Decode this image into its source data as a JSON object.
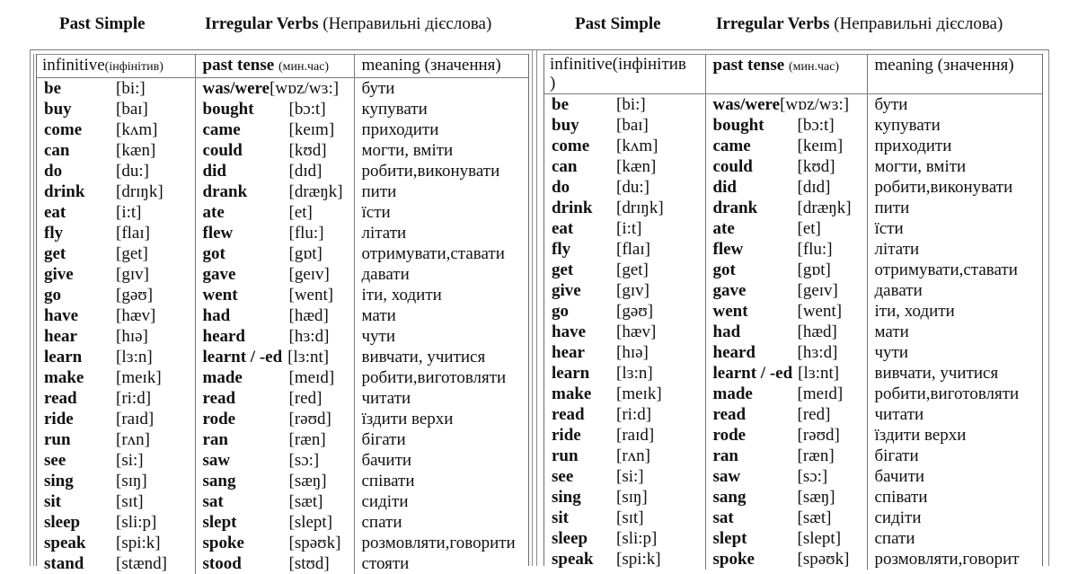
{
  "left": {
    "title_past": "Past Simple",
    "title_irregular": "Irregular Verbs",
    "title_ukr": "(Неправильні дієслова)",
    "headers": {
      "infinitive": "infinitive",
      "infinitive_ukr": "(інфінітив)",
      "past": "past tense",
      "past_ukr": "(мин.час)",
      "meaning": "meaning (значення)"
    },
    "rows": [
      {
        "inf": "be",
        "inf_pron": "[bi:]",
        "past": "was/were",
        "past_pron": "[wɒz/wɜ:]",
        "meaning": "бути"
      },
      {
        "inf": "buy",
        "inf_pron": "[baɪ]",
        "past": "bought",
        "past_pron": "[bɔ:t]",
        "meaning": "купувати"
      },
      {
        "inf": "come",
        "inf_pron": "[kʌm]",
        "past": "came",
        "past_pron": "[keɪm]",
        "meaning": "приходити"
      },
      {
        "inf": "can",
        "inf_pron": "[kæn]",
        "past": "could",
        "past_pron": "[kʊd]",
        "meaning": "могти, вміти"
      },
      {
        "inf": "do",
        "inf_pron": "[du:]",
        "past": "did",
        "past_pron": "[dɪd]",
        "meaning": "робити,виконувати"
      },
      {
        "inf": "drink",
        "inf_pron": "[drɪŋk]",
        "past": "drank",
        "past_pron": "[dræŋk]",
        "meaning": "пити"
      },
      {
        "inf": "eat",
        "inf_pron": "[i:t]",
        "past": "ate",
        "past_pron": "[et]",
        "meaning": "їсти"
      },
      {
        "inf": "fly",
        "inf_pron": "[flaɪ]",
        "past": "flew",
        "past_pron": "[flu:]",
        "meaning": "літати"
      },
      {
        "inf": "get",
        "inf_pron": "[get]",
        "past": "got",
        "past_pron": "[gɒt]",
        "meaning": "отримувати,ставати"
      },
      {
        "inf": "give",
        "inf_pron": "[gɪv]",
        "past": "gave",
        "past_pron": "[geɪv]",
        "meaning": "давати"
      },
      {
        "inf": "go",
        "inf_pron": "[gəʊ]",
        "past": "went",
        "past_pron": "[went]",
        "meaning": "іти, ходити"
      },
      {
        "inf": "have",
        "inf_pron": "[hæv]",
        "past": "had",
        "past_pron": "[hæd]",
        "meaning": "мати"
      },
      {
        "inf": "hear",
        "inf_pron": "[hɪə]",
        "past": "heard",
        "past_pron": "[hɜ:d]",
        "meaning": "чути"
      },
      {
        "inf": "learn",
        "inf_pron": "[lɜ:n]",
        "past": "learnt / -ed",
        "past_pron": "[lɜ:nt]",
        "meaning": "вивчати, учитися"
      },
      {
        "inf": "make",
        "inf_pron": "[meɪk]",
        "past": "made",
        "past_pron": "[meɪd]",
        "meaning": "робити,виготовляти"
      },
      {
        "inf": "read",
        "inf_pron": "[ri:d]",
        "past": "read",
        "past_pron": "[red]",
        "meaning": "читати"
      },
      {
        "inf": "ride",
        "inf_pron": "[raɪd]",
        "past": "rode",
        "past_pron": "[rəʊd]",
        "meaning": "їздити верхи"
      },
      {
        "inf": "run",
        "inf_pron": "[rʌn]",
        "past": "ran",
        "past_pron": "[ræn]",
        "meaning": "бігати"
      },
      {
        "inf": "see",
        "inf_pron": "[si:]",
        "past": "saw",
        "past_pron": "[sɔ:]",
        "meaning": "бачити"
      },
      {
        "inf": "sing",
        "inf_pron": "[sɪŋ]",
        "past": "sang",
        "past_pron": "[sæŋ]",
        "meaning": "співати"
      },
      {
        "inf": "sit",
        "inf_pron": "[sɪt]",
        "past": "sat",
        "past_pron": "[sæt]",
        "meaning": "сидіти"
      },
      {
        "inf": "sleep",
        "inf_pron": "[sli:p]",
        "past": "slept",
        "past_pron": "[slept]",
        "meaning": "спати"
      },
      {
        "inf": "speak",
        "inf_pron": "[spi:k]",
        "past": "spoke",
        "past_pron": "[spəʊk]",
        "meaning": "розмовляти,говорити"
      },
      {
        "inf": "stand",
        "inf_pron": "[stænd]",
        "past": "stood",
        "past_pron": "[stʊd]",
        "meaning": "стояти"
      }
    ]
  },
  "right": {
    "title_past": "Past Simple",
    "title_irregular": "Irregular Verbs",
    "title_ukr": "(Неправильні дієслова)",
    "headers": {
      "infinitive": "infinitive(інфінітив",
      "infinitive_wrap": ")",
      "past": "past tense",
      "past_ukr": "(мин.час)",
      "meaning": "meaning (значення)"
    },
    "rows": [
      {
        "inf": "be",
        "inf_pron": "[bi:]",
        "past": "was/were",
        "past_pron": "[wɒz/wɜ:]",
        "meaning": "бути"
      },
      {
        "inf": "buy",
        "inf_pron": "[baɪ]",
        "past": "bought",
        "past_pron": "[bɔ:t]",
        "meaning": "купувати"
      },
      {
        "inf": "come",
        "inf_pron": "[kʌm]",
        "past": "came",
        "past_pron": "[keɪm]",
        "meaning": "приходити"
      },
      {
        "inf": "can",
        "inf_pron": "[kæn]",
        "past": "could",
        "past_pron": "[kʊd]",
        "meaning": "могти, вміти"
      },
      {
        "inf": "do",
        "inf_pron": "[du:]",
        "past": "did",
        "past_pron": "[dɪd]",
        "meaning": "робити,виконувати"
      },
      {
        "inf": "drink",
        "inf_pron": "[drɪŋk]",
        "past": "drank",
        "past_pron": "[dræŋk]",
        "meaning": "пити"
      },
      {
        "inf": "eat",
        "inf_pron": "[i:t]",
        "past": "ate",
        "past_pron": "[et]",
        "meaning": "їсти"
      },
      {
        "inf": "fly",
        "inf_pron": "[flaɪ]",
        "past": "flew",
        "past_pron": "[flu:]",
        "meaning": "літати"
      },
      {
        "inf": "get",
        "inf_pron": "[get]",
        "past": "got",
        "past_pron": "[gɒt]",
        "meaning": "отримувати,ставати"
      },
      {
        "inf": "give",
        "inf_pron": "[gɪv]",
        "past": "gave",
        "past_pron": "[geɪv]",
        "meaning": "давати"
      },
      {
        "inf": "go",
        "inf_pron": "[gəʊ]",
        "past": "went",
        "past_pron": "[went]",
        "meaning": "іти, ходити"
      },
      {
        "inf": "have",
        "inf_pron": "[hæv]",
        "past": "had",
        "past_pron": "[hæd]",
        "meaning": "мати"
      },
      {
        "inf": "hear",
        "inf_pron": "[hɪə]",
        "past": "heard",
        "past_pron": "[hɜ:d]",
        "meaning": "чути"
      },
      {
        "inf": "learn",
        "inf_pron": "[lɜ:n]",
        "past": "learnt / -ed",
        "past_pron": "[lɜ:nt]",
        "meaning": "вивчати, учитися"
      },
      {
        "inf": "make",
        "inf_pron": "[meɪk]",
        "past": "made",
        "past_pron": "[meɪd]",
        "meaning": "робити,виготовляти"
      },
      {
        "inf": "read",
        "inf_pron": "[ri:d]",
        "past": "read",
        "past_pron": "[red]",
        "meaning": "читати"
      },
      {
        "inf": "ride",
        "inf_pron": "[raɪd]",
        "past": "rode",
        "past_pron": "[rəʊd]",
        "meaning": "їздити верхи"
      },
      {
        "inf": "run",
        "inf_pron": "[rʌn]",
        "past": "ran",
        "past_pron": "[ræn]",
        "meaning": "бігати"
      },
      {
        "inf": "see",
        "inf_pron": "[si:]",
        "past": "saw",
        "past_pron": "[sɔ:]",
        "meaning": "бачити"
      },
      {
        "inf": "sing",
        "inf_pron": "[sɪŋ]",
        "past": "sang",
        "past_pron": "[sæŋ]",
        "meaning": "співати"
      },
      {
        "inf": "sit",
        "inf_pron": "[sɪt]",
        "past": "sat",
        "past_pron": "[sæt]",
        "meaning": "сидіти"
      },
      {
        "inf": "sleep",
        "inf_pron": "[sli:p]",
        "past": "slept",
        "past_pron": "[slept]",
        "meaning": "спати"
      },
      {
        "inf": "speak",
        "inf_pron": "[spi:k]",
        "past": "spoke",
        "past_pron": "[spəʊk]",
        "meaning": "розмовляти,говорит"
      }
    ]
  }
}
